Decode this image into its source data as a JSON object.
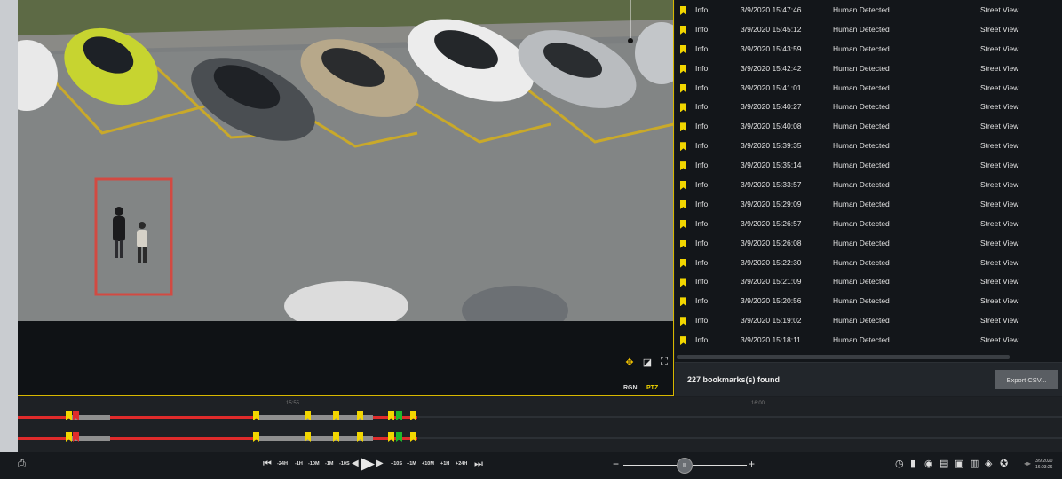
{
  "camera": {
    "rgn_label": "RGN",
    "ptz_label": "PTZ",
    "icons": [
      "move-arrows-icon",
      "image-adjust-icon",
      "fisheye-icon"
    ]
  },
  "bookmarks": {
    "rows": [
      {
        "level": "Info",
        "datetime": "3/9/2020 15:47:46",
        "event": "Human Detected",
        "camera": "Street View"
      },
      {
        "level": "Info",
        "datetime": "3/9/2020 15:45:12",
        "event": "Human Detected",
        "camera": "Street View"
      },
      {
        "level": "Info",
        "datetime": "3/9/2020 15:43:59",
        "event": "Human Detected",
        "camera": "Street View"
      },
      {
        "level": "Info",
        "datetime": "3/9/2020 15:42:42",
        "event": "Human Detected",
        "camera": "Street View"
      },
      {
        "level": "Info",
        "datetime": "3/9/2020 15:41:01",
        "event": "Human Detected",
        "camera": "Street View"
      },
      {
        "level": "Info",
        "datetime": "3/9/2020 15:40:27",
        "event": "Human Detected",
        "camera": "Street View"
      },
      {
        "level": "Info",
        "datetime": "3/9/2020 15:40:08",
        "event": "Human Detected",
        "camera": "Street View"
      },
      {
        "level": "Info",
        "datetime": "3/9/2020 15:39:35",
        "event": "Human Detected",
        "camera": "Street View"
      },
      {
        "level": "Info",
        "datetime": "3/9/2020 15:35:14",
        "event": "Human Detected",
        "camera": "Street View"
      },
      {
        "level": "Info",
        "datetime": "3/9/2020 15:33:57",
        "event": "Human Detected",
        "camera": "Street View"
      },
      {
        "level": "Info",
        "datetime": "3/9/2020 15:29:09",
        "event": "Human Detected",
        "camera": "Street View"
      },
      {
        "level": "Info",
        "datetime": "3/9/2020 15:26:57",
        "event": "Human Detected",
        "camera": "Street View"
      },
      {
        "level": "Info",
        "datetime": "3/9/2020 15:26:08",
        "event": "Human Detected",
        "camera": "Street View"
      },
      {
        "level": "Info",
        "datetime": "3/9/2020 15:22:30",
        "event": "Human Detected",
        "camera": "Street View"
      },
      {
        "level": "Info",
        "datetime": "3/9/2020 15:21:09",
        "event": "Human Detected",
        "camera": "Street View"
      },
      {
        "level": "Info",
        "datetime": "3/9/2020 15:20:56",
        "event": "Human Detected",
        "camera": "Street View"
      },
      {
        "level": "Info",
        "datetime": "3/9/2020 15:19:02",
        "event": "Human Detected",
        "camera": "Street View"
      },
      {
        "level": "Info",
        "datetime": "3/9/2020 15:18:11",
        "event": "Human Detected",
        "camera": "Street View"
      }
    ],
    "count_text": "227 bookmarks(s) found",
    "export_label": "Export CSV..."
  },
  "timeline": {
    "labels": [
      "15:55",
      "16:00"
    ],
    "bookmark_colors": [
      "yellow",
      "red",
      "yellow",
      "yellow",
      "yellow",
      "yellow",
      "yellow",
      "green",
      "yellow"
    ]
  },
  "controls": {
    "skip_back": [
      "-24H",
      "-1H",
      "-10M",
      "-1M",
      "-10S"
    ],
    "skip_forward": [
      "+10S",
      "+1M",
      "+10M",
      "+1H",
      "+24H"
    ],
    "zoom_minus": "−",
    "zoom_plus": "+",
    "pause_glyph": "II",
    "toolbar_icons": [
      "clock-icon",
      "bookmark-icon",
      "camera-snapshot-icon",
      "archive-icon",
      "export-video-icon",
      "delete-icon",
      "protect-icon",
      "help-icon"
    ],
    "clock_date": "3/9/2020",
    "clock_time": "16:03:26"
  },
  "colors": {
    "accent_yellow": "#f2d600",
    "bookmark_red": "#e02b2b",
    "bookmark_green": "#1fb92c",
    "detection_box": "#d24a42"
  }
}
